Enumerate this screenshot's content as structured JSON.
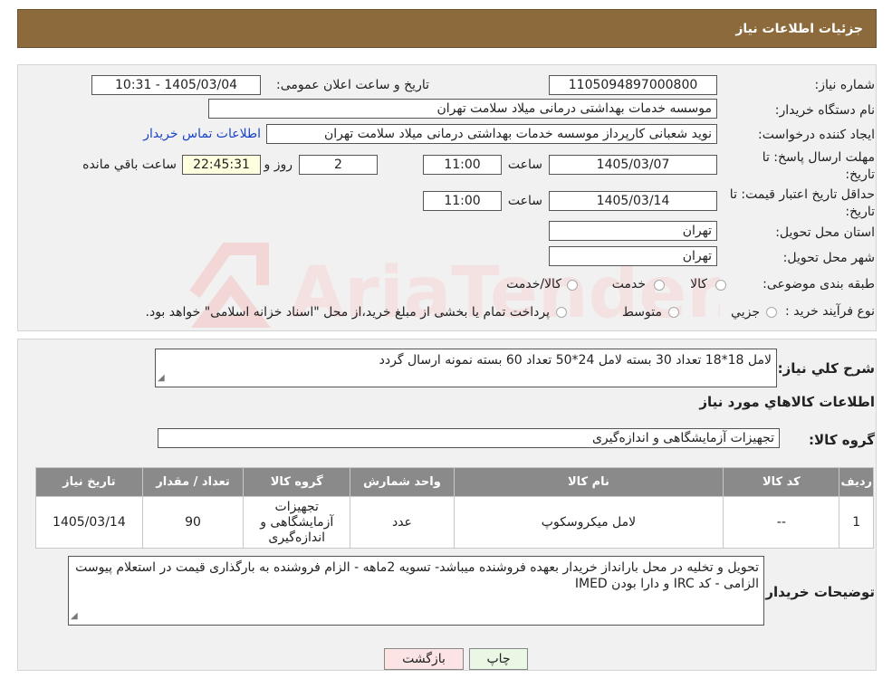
{
  "header": {
    "title": "جزئیات اطلاعات نیاز"
  },
  "form": {
    "need_number": {
      "label": "شماره نیاز:",
      "value": "1105094897000800"
    },
    "announce_datetime": {
      "label": "تاریخ و ساعت اعلان عمومی:",
      "value": "1405/03/04 - 10:31"
    },
    "buyer_org": {
      "label": "نام دستگاه خریدار:",
      "value": "موسسه خدمات بهداشتی درمانی میلاد سلامت تهران"
    },
    "requester": {
      "label": "ایجاد کننده درخواست:",
      "value": "نوید شعبانی کارپرداز موسسه خدمات بهداشتی درمانی میلاد سلامت تهران",
      "contact_link": "اطلاعات تماس خریدار"
    },
    "reply_deadline": {
      "label": "مهلت ارسال پاسخ: تا تاریخ:",
      "date": "1405/03/07",
      "time_label": "ساعت",
      "time": "11:00",
      "days": "2",
      "days_label": "روز و",
      "remaining": "22:45:31",
      "remaining_label": "ساعت باقي مانده"
    },
    "price_validity": {
      "label": "حداقل تاریخ اعتبار قیمت: تا تاریخ:",
      "date": "1405/03/14",
      "time_label": "ساعت",
      "time": "11:00"
    },
    "delivery_province": {
      "label": "استان محل تحویل:",
      "value": "تهران"
    },
    "delivery_city": {
      "label": "شهر محل تحویل:",
      "value": "تهران"
    },
    "category": {
      "label": "طبقه بندی موضوعی:",
      "options": [
        "کالا",
        "خدمت",
        "کالا/خدمت"
      ]
    },
    "process_type": {
      "label": "نوع فرآیند خرید :",
      "options": [
        "جزیي",
        "متوسط"
      ],
      "note": "پرداخت تمام یا بخشی از مبلغ خرید،از محل \"اسناد خزانه اسلامی\" خواهد بود."
    }
  },
  "description": {
    "label": "شرح کلي نياز:",
    "value": "لامل 18*18 تعداد 30 بسته       لامل 24*50  تعداد 60 بسته     نمونه ارسال گردد"
  },
  "goods_section_title": "اطلاعات کالاهاي مورد نياز",
  "goods_group": {
    "label": "گروه کالا:",
    "value": "تجهیزات آزمایشگاهی و اندازه‌گیری"
  },
  "table": {
    "headers": [
      "رديف",
      "کد کالا",
      "نام کالا",
      "واحد شمارش",
      "گروه کالا",
      "تعداد / مقدار",
      "تاریخ نیاز"
    ],
    "rows": [
      [
        "1",
        "--",
        "لامل میکروسکوپ",
        "عدد",
        "تجهیزات آزمایشگاهی و اندازه‌گیری",
        "90",
        "1405/03/14"
      ]
    ]
  },
  "buyer_notes": {
    "label": "توضیحات خریدار:",
    "value": "تحویل و تخلیه در محل بارانداز خریدار بعهده فروشنده میباشد- تسویه 2ماهه - الزام فروشنده به بارگذاری قیمت در استعلام پیوست الزامی - کد IRC و دارا بودن IMED"
  },
  "buttons": {
    "print": "چاپ",
    "back": "بازگشت"
  },
  "watermark": {
    "text": "AriaTender.neT"
  },
  "colors": {
    "header": "#8c6a3c",
    "table_header": "#8a8a8a",
    "back_button": "#fde4e4",
    "print_button": "#e9f7e4",
    "link": "#1a44c8"
  }
}
